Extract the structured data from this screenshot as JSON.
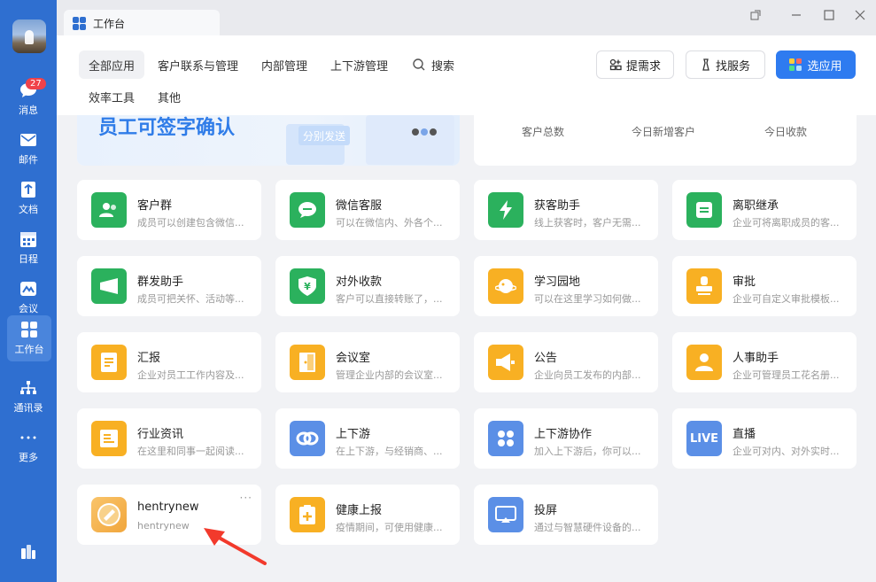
{
  "rail": {
    "items": [
      {
        "label": "消息",
        "icon": "chat-icon",
        "badge": "27"
      },
      {
        "label": "邮件",
        "icon": "mail-icon"
      },
      {
        "label": "文档",
        "icon": "document-icon"
      },
      {
        "label": "日程",
        "icon": "calendar-icon"
      },
      {
        "label": "会议",
        "icon": "meeting-icon"
      },
      {
        "label": "工作台",
        "icon": "workbench-grid-icon",
        "active": true
      },
      {
        "label": "通讯录",
        "icon": "contacts-icon"
      },
      {
        "label": "更多",
        "icon": "more-dots-icon"
      }
    ]
  },
  "window": {
    "tab_title": "工作台"
  },
  "nav": {
    "tabs": [
      "全部应用",
      "客户联系与管理",
      "内部管理",
      "上下游管理",
      "搜索",
      "效率工具",
      "其他"
    ],
    "buttons": {
      "request": "提需求",
      "service": "找服务",
      "choose": "选应用"
    }
  },
  "banner": {
    "title": "员工可签字确认",
    "send_label": "分别发送",
    "stats": [
      "客户总数",
      "今日新增客户",
      "今日收款"
    ]
  },
  "apps": [
    {
      "name": "客户群",
      "desc": "成员可以创建包含微信...",
      "color": "#2bb15d",
      "icon": "group-icon"
    },
    {
      "name": "微信客服",
      "desc": "可以在微信内、外各个...",
      "color": "#2bb15d",
      "icon": "chat-bubble-icon"
    },
    {
      "name": "获客助手",
      "desc": "线上获客时，客户无需...",
      "color": "#2bb15d",
      "icon": "lightning-icon"
    },
    {
      "name": "离职继承",
      "desc": "企业可将离职成员的客...",
      "color": "#2bb15d",
      "icon": "transfer-icon"
    },
    {
      "name": "群发助手",
      "desc": "成员可把关怀、活动等...",
      "color": "#2bb15d",
      "icon": "megaphone-icon"
    },
    {
      "name": "对外收款",
      "desc": "客户可以直接转账了，...",
      "color": "#2bb15d",
      "icon": "yen-shield-icon"
    },
    {
      "name": "学习园地",
      "desc": "可以在这里学习如何做...",
      "color": "#f8b023",
      "icon": "planet-icon"
    },
    {
      "name": "审批",
      "desc": "企业可自定义审批模板...",
      "color": "#f8b023",
      "icon": "stamp-icon"
    },
    {
      "name": "汇报",
      "desc": "企业对员工工作内容及...",
      "color": "#f8b023",
      "icon": "report-icon"
    },
    {
      "name": "会议室",
      "desc": "管理企业内部的会议室...",
      "color": "#f8b023",
      "icon": "door-icon"
    },
    {
      "name": "公告",
      "desc": "企业向员工发布的内部...",
      "color": "#f8b023",
      "icon": "announcement-icon"
    },
    {
      "name": "人事助手",
      "desc": "企业可管理员工花名册...",
      "color": "#f8b023",
      "icon": "person-icon"
    },
    {
      "name": "行业资讯",
      "desc": "在这里和同事一起阅读...",
      "color": "#f8b023",
      "icon": "news-icon"
    },
    {
      "name": "上下游",
      "desc": "在上下游，与经销商、...",
      "color": "#5b8fe6",
      "icon": "link-icon"
    },
    {
      "name": "上下游协作",
      "desc": "加入上下游后，你可以...",
      "color": "#5b8fe6",
      "icon": "apps-icon"
    },
    {
      "name": "直播",
      "desc": "企业可对内、对外实时...",
      "color": "#5b8fe6",
      "icon": "live-icon",
      "icon_text": "LIVE"
    },
    {
      "name": "hentrynew",
      "desc": "hentrynew",
      "color": "#f8b023",
      "icon": "custom-app-icon",
      "more": "···"
    },
    {
      "name": "健康上报",
      "desc": "疫情期间，可使用健康...",
      "color": "#f8b023",
      "icon": "health-report-icon"
    },
    {
      "name": "投屏",
      "desc": "通过与智慧硬件设备的...",
      "color": "#5b8fe6",
      "icon": "screen-cast-icon"
    }
  ]
}
